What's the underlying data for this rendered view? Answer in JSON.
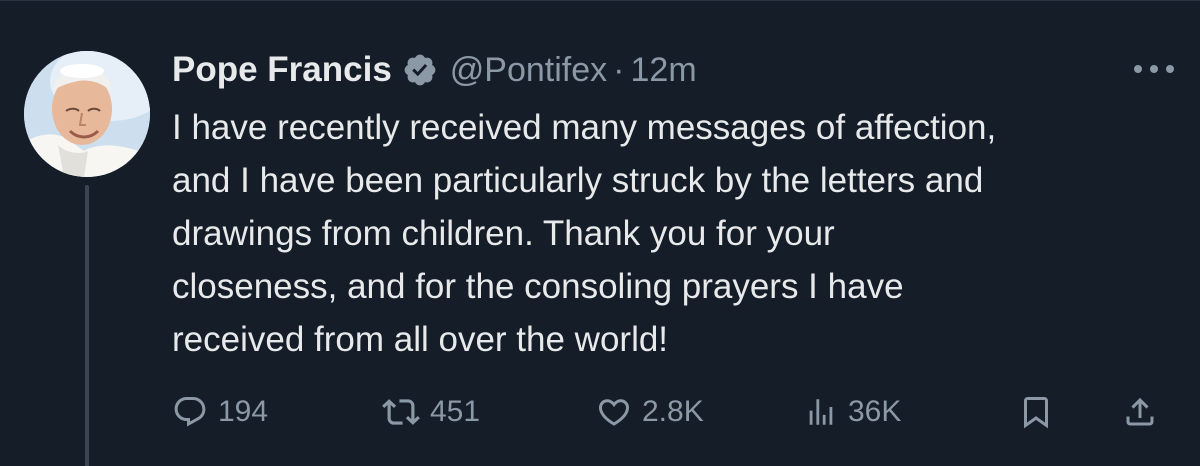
{
  "author": {
    "name": "Pope Francis",
    "handle": "@Pontifex",
    "separator": "·",
    "time": "12m",
    "verified": true
  },
  "tweet": {
    "lines": [
      "I have recently received many messages of affection,",
      "and I have been particularly struck by the letters and",
      "drawings from children. Thank you for your",
      "closeness, and for the consoling prayers I have",
      "received from all over the world!"
    ]
  },
  "actions": {
    "replies": "194",
    "retweets": "451",
    "likes": "2.8K",
    "views": "36K"
  },
  "icons": {
    "verified": "verified-badge-icon",
    "more": "more-dots-icon",
    "reply": "reply-icon",
    "retweet": "retweet-icon",
    "like": "heart-icon",
    "views": "views-bar-icon",
    "bookmark": "bookmark-icon",
    "share": "share-icon"
  },
  "colors": {
    "background": "#151d28",
    "text": "#e7e9ea",
    "secondary": "#8b98a5",
    "thread_line": "#3b4551"
  }
}
